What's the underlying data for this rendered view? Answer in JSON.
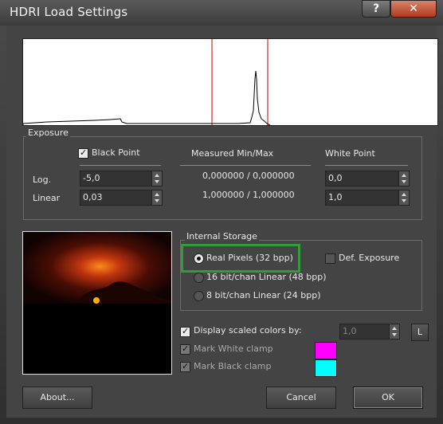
{
  "window": {
    "title": "HDRI Load Settings",
    "help_label": "?",
    "close_label": "✕"
  },
  "exposure": {
    "group_label": "Exposure",
    "black_point_label": "Black Point",
    "black_point_checked": true,
    "measured_label": "Measured Min/Max",
    "white_point_label": "White Point",
    "log_label": "Log.",
    "linear_label": "Linear",
    "black_log": "-5,0",
    "black_linear": "0,03",
    "measured_log": "0,000000 / 0,000000",
    "measured_linear": "1,000000 / 1,000000",
    "white_log": "0,0",
    "white_linear": "1,0"
  },
  "storage": {
    "group_label": "Internal Storage",
    "options": [
      "Real Pixels (32 bpp)",
      "16 bit/chan Linear (48 bpp)",
      "8 bit/chan Linear (24 bpp)"
    ],
    "selected_index": 0,
    "def_exposure_label": "Def. Exposure",
    "def_exposure_checked": false,
    "highlight_color": "#2e9e3a"
  },
  "display": {
    "scaled_label": "Display scaled colors by:",
    "scaled_checked": true,
    "scale_value": "1,0",
    "l_button": "L",
    "white_clamp_label": "Mark White clamp",
    "white_clamp_checked": true,
    "white_clamp_color": "#ff00ff",
    "black_clamp_label": "Mark Black clamp",
    "black_clamp_checked": true,
    "black_clamp_color": "#00ffff"
  },
  "buttons": {
    "about": "About...",
    "cancel": "Cancel",
    "ok": "OK"
  },
  "colors": {
    "marker_lines": "#cc0000"
  }
}
